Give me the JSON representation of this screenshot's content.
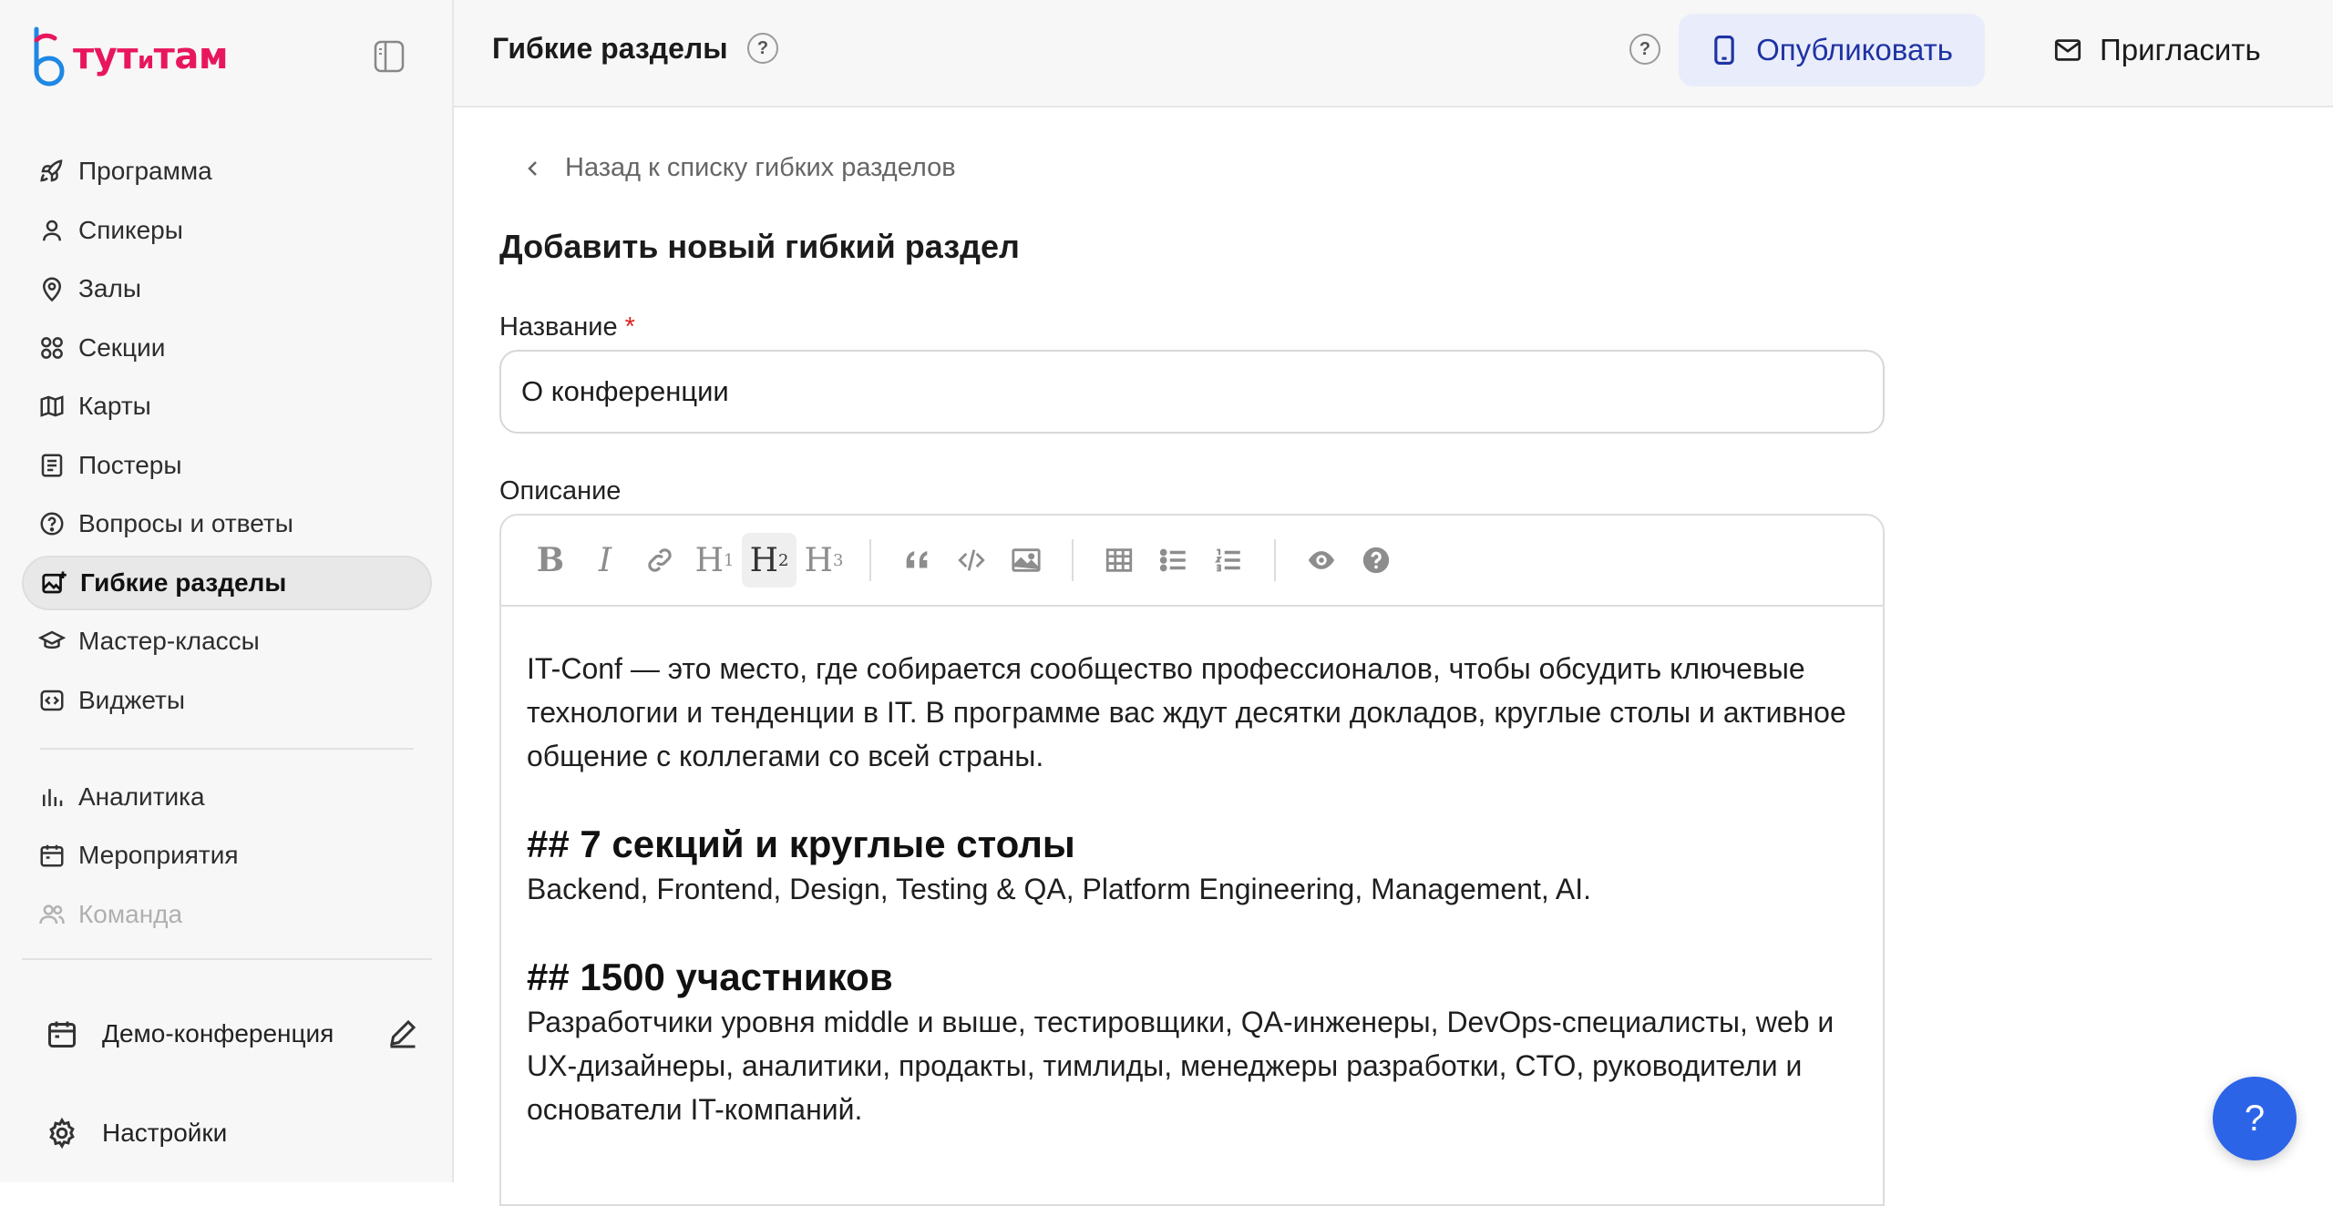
{
  "logo": {
    "text_main": "тут",
    "text_small": "и",
    "text_end": "там",
    "brand_color": "#e8175d",
    "accent_color": "#1e88e5"
  },
  "sidebar": {
    "items": [
      {
        "label": "Программа",
        "icon": "rocket-icon"
      },
      {
        "label": "Спикеры",
        "icon": "user-icon"
      },
      {
        "label": "Залы",
        "icon": "map-pin-icon"
      },
      {
        "label": "Секции",
        "icon": "grid-circles-icon"
      },
      {
        "label": "Карты",
        "icon": "map-icon"
      },
      {
        "label": "Постеры",
        "icon": "poster-icon"
      },
      {
        "label": "Вопросы и ответы",
        "icon": "question-circle-icon"
      },
      {
        "label": "Гибкие разделы",
        "icon": "image-plus-icon",
        "active": true
      },
      {
        "label": "Мастер-классы",
        "icon": "graduation-cap-icon"
      },
      {
        "label": "Виджеты",
        "icon": "code-icon"
      }
    ],
    "secondary_items": [
      {
        "label": "Аналитика",
        "icon": "chart-bars-icon"
      },
      {
        "label": "Мероприятия",
        "icon": "calendar-icon"
      },
      {
        "label": "Команда",
        "icon": "users-icon"
      }
    ],
    "event_name": "Демо-конференция",
    "settings_label": "Настройки"
  },
  "header": {
    "title": "Гибкие разделы",
    "help": "?",
    "publish_label": "Опубликовать",
    "invite_label": "Пригласить"
  },
  "main": {
    "back_label": "Назад к списку гибких разделов",
    "section_title": "Добавить новый гибкий раздел",
    "name_label": "Название",
    "required_mark": "*",
    "name_value": "О конференции",
    "description_label": "Описание",
    "toolbar": {
      "bold": "B",
      "italic": "I",
      "h1": "H",
      "h1_sub": "1",
      "h2": "H",
      "h2_sub": "2",
      "h3": "H",
      "h3_sub": "3"
    },
    "content": {
      "p1": "IT-Conf — это место, где собирается сообщество профессионалов, чтобы обсудить ключевые технологии и тенденции в IT. В программе вас ждут десятки докладов, круглые столы и активное общение с коллегами со всей страны.",
      "h2_1": "## 7 секций и круглые столы",
      "p2": "Backend, Frontend, Design, Testing & QA, Platform Engineering, Management, AI.",
      "h2_2": "## 1500 участников",
      "p3": "Разработчики уровня middle и выше, тестировщики, QA-инженеры, DevOps-специалисты, web и UX-дизайнеры, аналитики, продакты, тимлиды, менеджеры разработки, CTO, руководители и основатели IT-компаний."
    }
  },
  "fab_label": "?"
}
